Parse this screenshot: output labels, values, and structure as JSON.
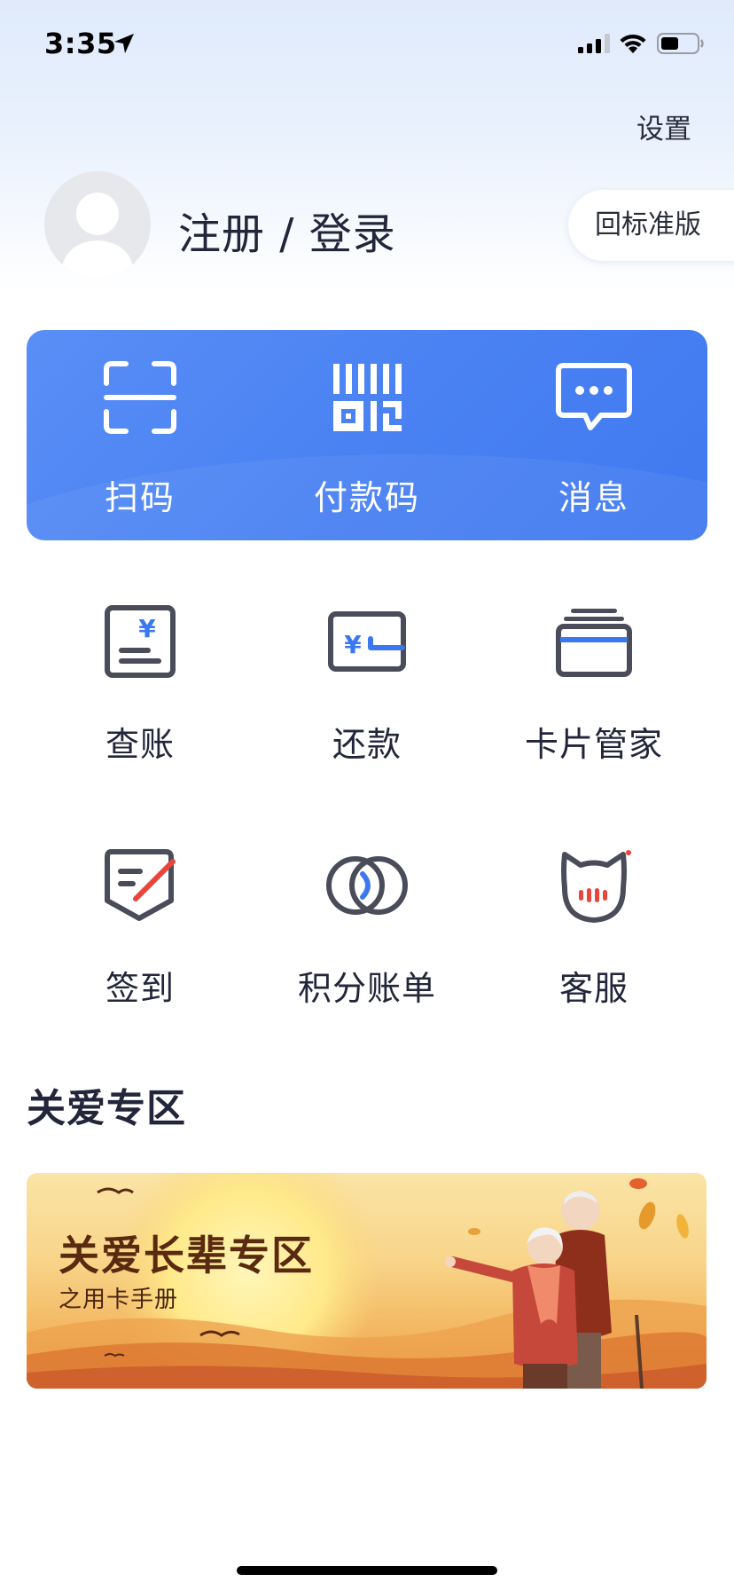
{
  "status_bar": {
    "time": "3:35"
  },
  "header": {
    "settings_label": "设置",
    "login_label": "注册 / 登录",
    "standard_version_label": "回标准版"
  },
  "quick_actions": [
    {
      "label": "扫码",
      "icon": "scan-icon"
    },
    {
      "label": "付款码",
      "icon": "payment-code-icon"
    },
    {
      "label": "消息",
      "icon": "message-icon"
    }
  ],
  "services": [
    {
      "label": "查账",
      "icon": "bill-query-icon"
    },
    {
      "label": "还款",
      "icon": "repayment-icon"
    },
    {
      "label": "卡片管家",
      "icon": "card-manager-icon"
    },
    {
      "label": "签到",
      "icon": "check-in-icon"
    },
    {
      "label": "积分账单",
      "icon": "points-bill-icon"
    },
    {
      "label": "客服",
      "icon": "customer-service-icon"
    }
  ],
  "care_section": {
    "title": "关爱专区",
    "banner": {
      "title": "关爱长辈专区",
      "subtitle": "之用卡手册"
    }
  },
  "colors": {
    "accent_blue": "#4a82f3",
    "icon_gray": "#4a4c5a",
    "icon_blue": "#3b78f0",
    "icon_red": "#e8453c"
  }
}
